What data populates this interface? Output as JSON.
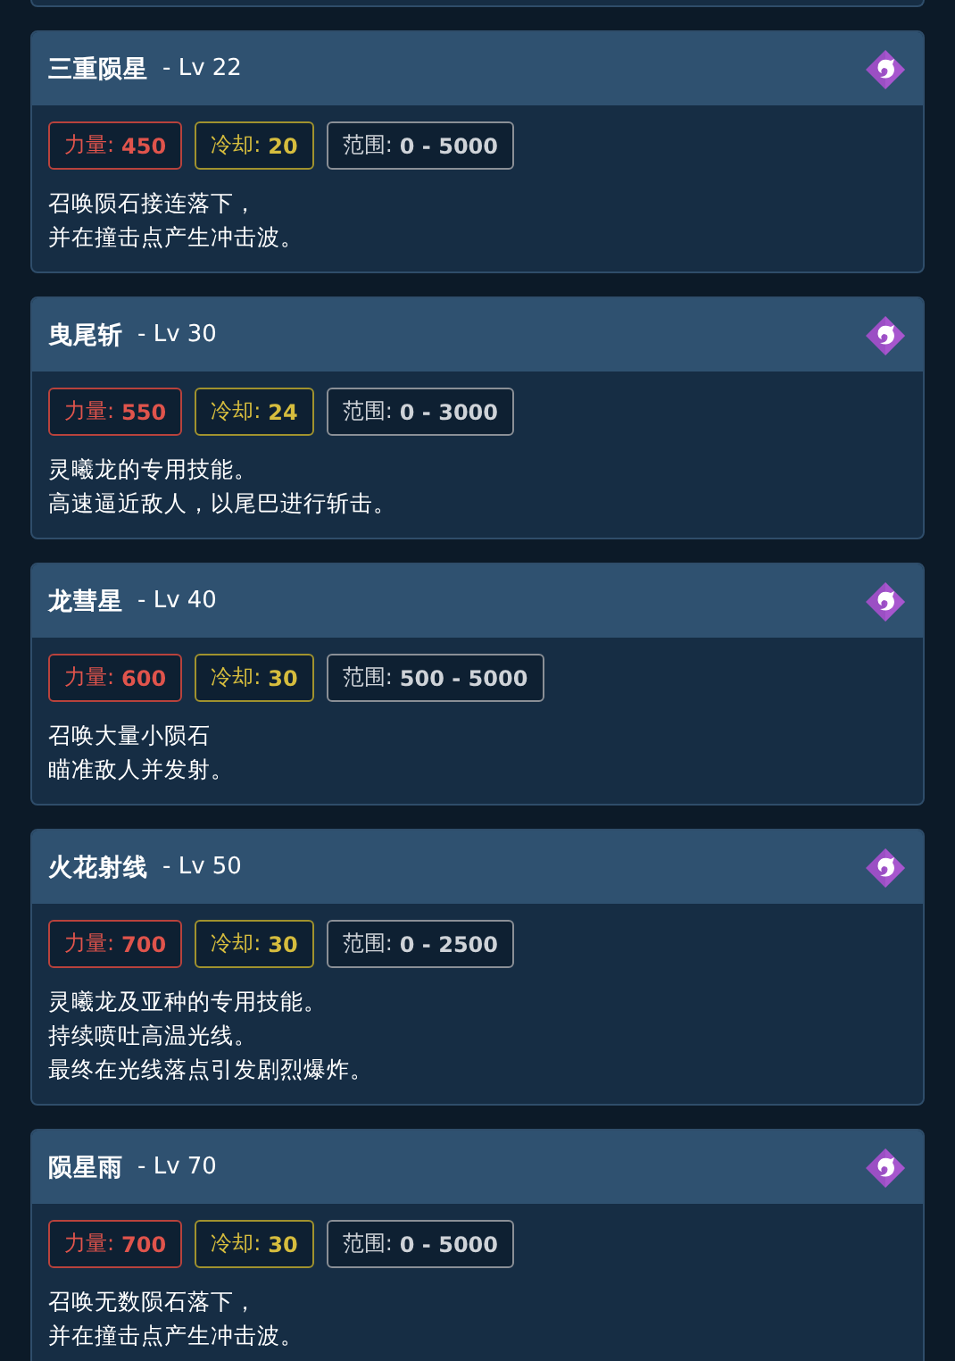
{
  "skills": [
    {
      "name": "三重陨星",
      "level": "- Lv 22",
      "stats": [
        {
          "kind": "power",
          "label": "力量:",
          "value": "450"
        },
        {
          "kind": "cooldown",
          "label": "冷却:",
          "value": "20"
        },
        {
          "kind": "range",
          "label": "范围:",
          "value": "0 - 5000"
        }
      ],
      "description": [
        "召唤陨石接连落下，",
        "并在撞击点产生冲击波。"
      ]
    },
    {
      "name": "曳尾斩",
      "level": "- Lv 30",
      "stats": [
        {
          "kind": "power",
          "label": "力量:",
          "value": "550"
        },
        {
          "kind": "cooldown",
          "label": "冷却:",
          "value": "24"
        },
        {
          "kind": "range",
          "label": "范围:",
          "value": "0 - 3000"
        }
      ],
      "description": [
        "灵曦龙的专用技能。",
        "高速逼近敌人，以尾巴进行斩击。"
      ]
    },
    {
      "name": "龙彗星",
      "level": "- Lv 40",
      "stats": [
        {
          "kind": "power",
          "label": "力量:",
          "value": "600"
        },
        {
          "kind": "cooldown",
          "label": "冷却:",
          "value": "30"
        },
        {
          "kind": "range",
          "label": "范围:",
          "value": "500 - 5000"
        }
      ],
      "description": [
        "召唤大量小陨石",
        "瞄准敌人并发射。"
      ]
    },
    {
      "name": "火花射线",
      "level": "- Lv 50",
      "stats": [
        {
          "kind": "power",
          "label": "力量:",
          "value": "700"
        },
        {
          "kind": "cooldown",
          "label": "冷却:",
          "value": "30"
        },
        {
          "kind": "range",
          "label": "范围:",
          "value": "0 - 2500"
        }
      ],
      "description": [
        "灵曦龙及亚种的专用技能。",
        "持续喷吐高温光线。",
        "最终在光线落点引发剧烈爆炸。"
      ]
    },
    {
      "name": "陨星雨",
      "level": "- Lv 70",
      "stats": [
        {
          "kind": "power",
          "label": "力量:",
          "value": "700"
        },
        {
          "kind": "cooldown",
          "label": "冷却:",
          "value": "30"
        },
        {
          "kind": "range",
          "label": "范围:",
          "value": "0 - 5000"
        }
      ],
      "description": [
        "召唤无数陨石落下，",
        "并在撞击点产生冲击波。"
      ]
    }
  ]
}
